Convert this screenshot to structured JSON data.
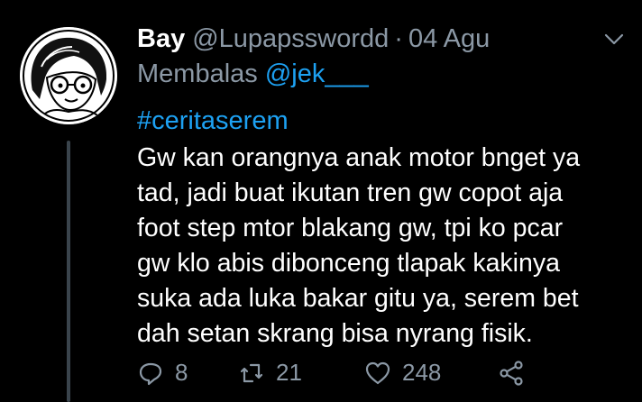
{
  "tweet": {
    "author_name": "Bay",
    "handle": "@Lupapsswordd",
    "separator": "·",
    "date": "04 Agu",
    "reply_prefix": "Membalas",
    "reply_to": "@jek___",
    "hashtag": "#ceritaserem",
    "text": " Gw kan orangnya anak motor bnget ya\ntad, jadi buat ikutan tren gw copot aja\nfoot step mtor blakang gw, tpi ko pcar\ngw klo abis dibonceng tlapak kakinya\nsuka ada luka bakar gitu ya, serem bet\ndah setan skrang bisa nyrang fisik."
  },
  "actions": {
    "replies": "8",
    "retweets": "21",
    "likes": "248"
  },
  "icons": {
    "menu": "chevron-down-icon",
    "reply": "reply-icon",
    "retweet": "retweet-icon",
    "like": "heart-icon",
    "share": "share-icon"
  },
  "colors": {
    "background": "#000000",
    "text": "#ffffff",
    "secondary": "#8b98a5",
    "link": "#1da1f2",
    "thread_line": "#3a444c"
  }
}
